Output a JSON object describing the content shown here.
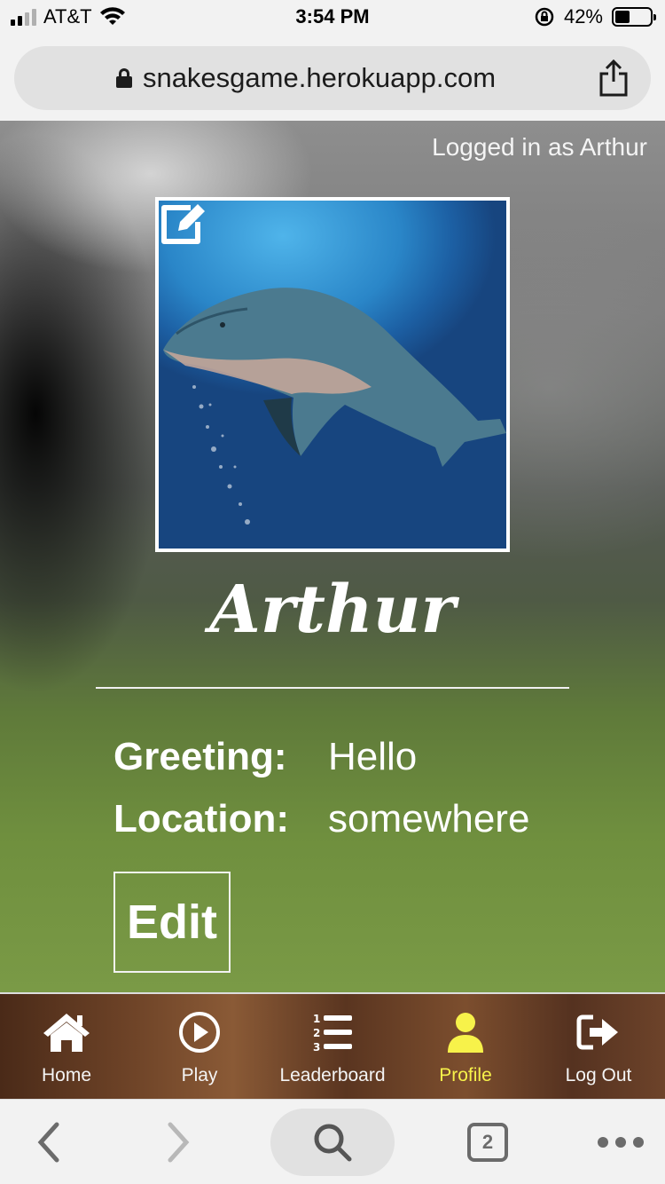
{
  "status_bar": {
    "carrier": "AT&T",
    "time": "3:54 PM",
    "battery_percent": "42%",
    "battery_level": 0.42,
    "icons": [
      "signal-icon",
      "wifi-icon",
      "orientation-lock-icon",
      "battery-icon"
    ]
  },
  "browser": {
    "url": "snakesgame.herokuapp.com",
    "tab_count": "2",
    "icons": [
      "lock-icon",
      "share-icon",
      "back-icon",
      "forward-icon",
      "search-icon",
      "tabs-icon",
      "more-icon"
    ]
  },
  "profile": {
    "logged_in_text": "Logged in as Arthur",
    "username": "Arthur",
    "greeting_label": "Greeting:",
    "greeting_value": "Hello",
    "location_label": "Location:",
    "location_value": "somewhere",
    "edit_label": "Edit",
    "avatar_icon": "dolphin-photo",
    "edit_avatar_icon": "edit-icon"
  },
  "nav": {
    "items": [
      {
        "label": "Home",
        "icon": "home-icon",
        "active": false
      },
      {
        "label": "Play",
        "icon": "play-icon",
        "active": false
      },
      {
        "label": "Leaderboard",
        "icon": "leaderboard-icon",
        "active": false
      },
      {
        "label": "Profile",
        "icon": "profile-icon",
        "active": true
      },
      {
        "label": "Log Out",
        "icon": "logout-icon",
        "active": false
      }
    ]
  },
  "colors": {
    "active_nav": "#f7f24a",
    "text_light": "#ffffff"
  }
}
